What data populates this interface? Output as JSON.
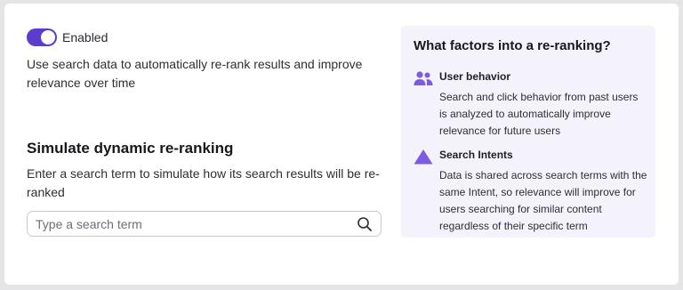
{
  "colors": {
    "accent": "#5b3ccf",
    "icon": "#7c5ce0",
    "panel_bg": "#f4f2fb",
    "page_bg": "#e5e5e8"
  },
  "auto_rerank": {
    "toggle_label": "Enabled",
    "enabled": true,
    "description": "Use search data to automatically re-rank results and improve relevance over time"
  },
  "simulate": {
    "title": "Simulate dynamic re-ranking",
    "description": "Enter a search term to simulate how its search results will be re-ranked",
    "search": {
      "placeholder": "Type a search term",
      "value": "",
      "icon": "search-icon"
    }
  },
  "info": {
    "title": "What factors into a re-ranking?",
    "factors": [
      {
        "icon": "users-icon",
        "name": "User behavior",
        "description": "Search and click behavior from past users is analyzed to automatically improve relevance for future users"
      },
      {
        "icon": "triangle-icon",
        "name": "Search Intents",
        "description": "Data is shared across search terms with the same Intent, so relevance will improve for users searching for similar content regardless of their specific term"
      }
    ]
  }
}
